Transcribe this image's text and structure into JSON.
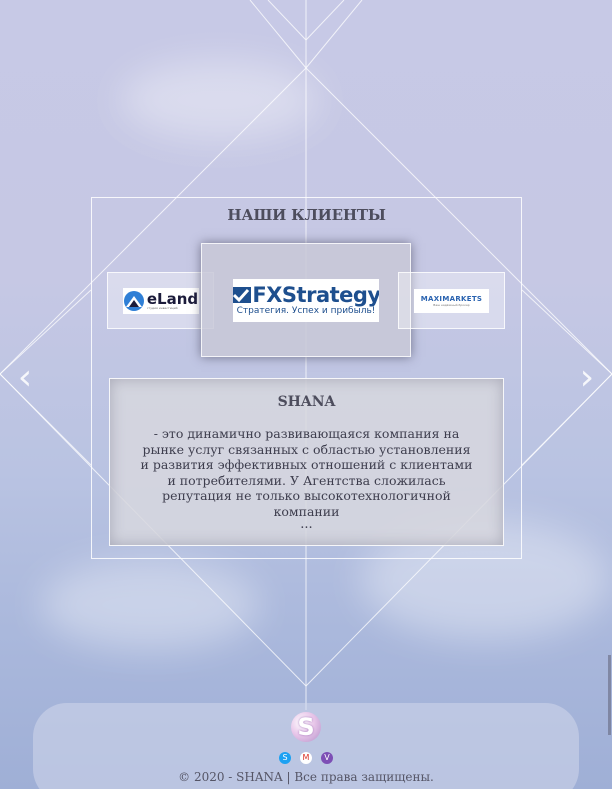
{
  "section": {
    "title": "НАШИ КЛИЕНТЫ"
  },
  "clients": [
    {
      "name": "eLand",
      "subtitle": "студия инвестиций"
    },
    {
      "name": "FXStrategy",
      "tagline": "Стратегия. Успех и прибыль!"
    },
    {
      "name": "MAXIMARKETS",
      "subtitle": "Ваш надёжный брокер"
    }
  ],
  "description": {
    "company": "SHANA",
    "text": "- это динамично развивающаяся компания на рынке услуг связанных с областью установления и развития эффективных отношений с клиентами и потребителями. У Агентства сложилась репутация не только высокотехнологичной компании",
    "more": "..."
  },
  "nav": {
    "prev_icon": "‹",
    "next_icon": "›"
  },
  "footer": {
    "logo_letter": "S",
    "social": [
      {
        "name": "skype",
        "glyph": "S",
        "color": "#1da1f2"
      },
      {
        "name": "gmail",
        "glyph": "M",
        "color": "#d93025"
      },
      {
        "name": "viber",
        "glyph": "V",
        "color": "#7d4fb5"
      }
    ],
    "copyright": "© 2020 - SHANA | Все права защищены."
  }
}
